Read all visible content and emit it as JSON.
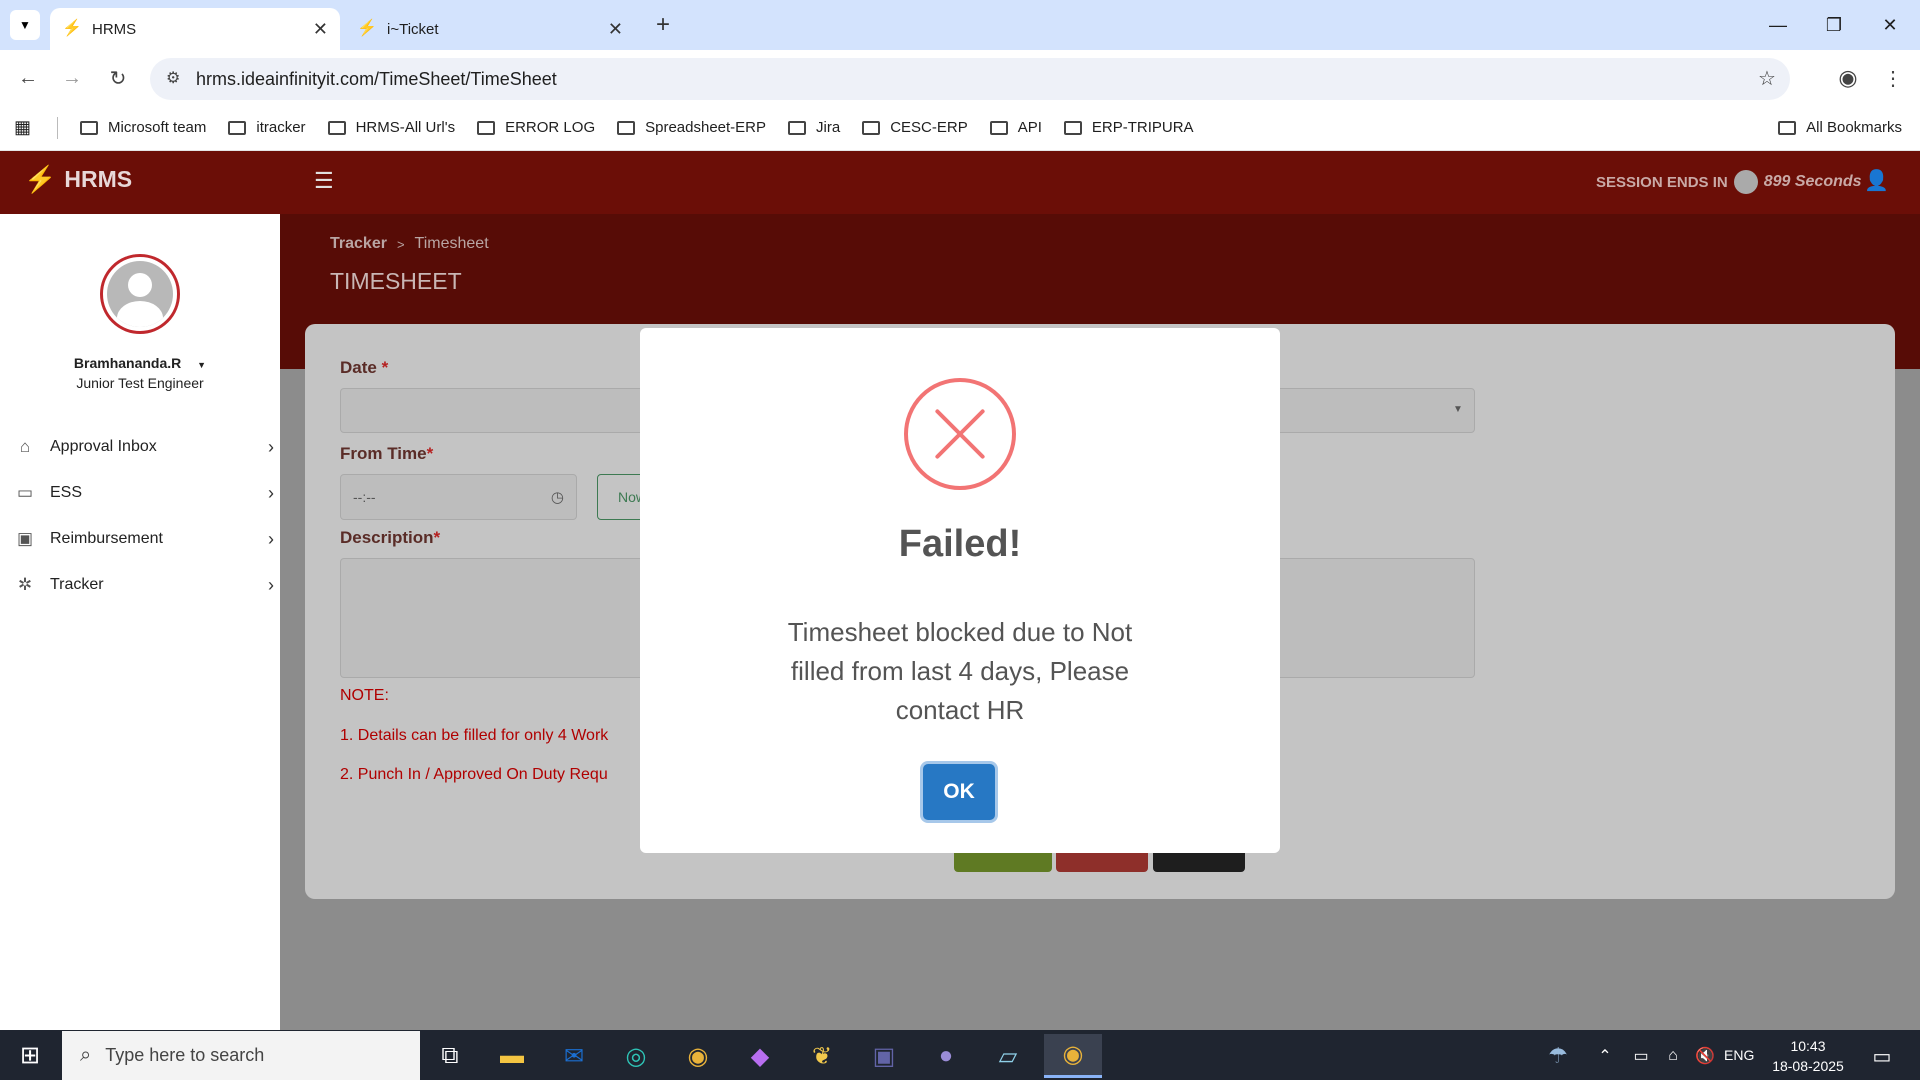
{
  "browser": {
    "tabs": [
      {
        "title": "HRMS",
        "active": true
      },
      {
        "title": "i~Ticket",
        "active": false
      }
    ],
    "new_tab": "+",
    "url": "hrms.ideainfinityit.com/TimeSheet/TimeSheet",
    "bookmarks": [
      "Microsoft team",
      "itracker",
      "HRMS-All Url's",
      "ERROR LOG",
      "Spreadsheet-ERP",
      "Jira",
      "CESC-ERP",
      "API",
      "ERP-TRIPURA"
    ],
    "all_bookmarks": "All Bookmarks"
  },
  "app": {
    "logo_text": "HRMS",
    "session_label": "SESSION ENDS IN",
    "session_value": "899 Seconds",
    "brand_color": "#6b0e07"
  },
  "user": {
    "name": "Bramhananda.R",
    "role": "Junior Test Engineer"
  },
  "sidebar": {
    "items": [
      {
        "label": "Approval Inbox",
        "icon": "home-icon"
      },
      {
        "label": "ESS",
        "icon": "monitor-icon"
      },
      {
        "label": "Reimbursement",
        "icon": "money-icon"
      },
      {
        "label": "Tracker",
        "icon": "tracker-icon"
      }
    ]
  },
  "page": {
    "breadcrumb_root": "Tracker",
    "breadcrumb_sep": ">",
    "breadcrumb_current": "Timesheet",
    "title": "TIMESHEET"
  },
  "form": {
    "date_label": "Date",
    "from_time_label": "From Time",
    "time_placeholder": "--:--",
    "now_button": "Now",
    "description_label": "Description",
    "required_mark": "*",
    "note_heading": "NOTE:",
    "note_1": "1. Details can be filled for only 4 Work",
    "note_2": "2. Punch In / Approved On Duty Requ"
  },
  "dialog": {
    "title": "Failed!",
    "message_line1": "Timesheet blocked due to Not",
    "message_line2": "filled from last 4 days, Please",
    "message_line3": "contact HR",
    "ok_label": "OK",
    "error_color": "#f27474"
  },
  "taskbar": {
    "search_placeholder": "Type here to search",
    "language": "ENG",
    "time": "10:43",
    "date": "18-08-2025"
  }
}
